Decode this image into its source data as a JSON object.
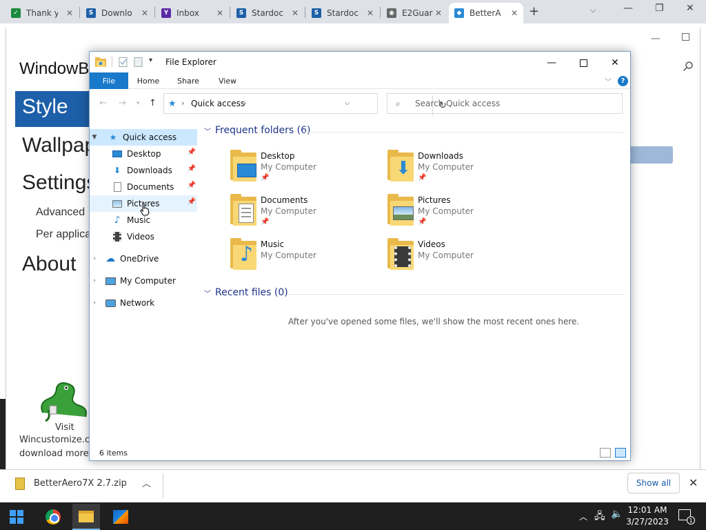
{
  "browser": {
    "tabs": [
      {
        "label": "Thank yo",
        "fav_color": "#1b8a3c",
        "fav_glyph": "✓"
      },
      {
        "label": "Downlo",
        "fav_color": "#1d5fa8",
        "fav_glyph": "S"
      },
      {
        "label": "Inbox",
        "fav_color": "#5b2aa6",
        "fav_glyph": "Y"
      },
      {
        "label": "Stardoc",
        "fav_color": "#1d5fa8",
        "fav_glyph": "S"
      },
      {
        "label": "Stardoc",
        "fav_color": "#1d5fa8",
        "fav_glyph": "S"
      },
      {
        "label": "E2Guar",
        "fav_color": "#666666",
        "fav_glyph": "◉"
      },
      {
        "label": "BetterA",
        "fav_color": "#2a8ad4",
        "fav_glyph": "◆"
      }
    ],
    "new_tab": "+"
  },
  "background_app": {
    "title": "WindowB",
    "nav_active": "Style",
    "nav": [
      "Wallpap",
      "Settings"
    ],
    "sub": [
      "Advanced",
      "Per applicat"
    ],
    "about": "About",
    "visit": "Visit",
    "wincustomize": "Wincustomize.co",
    "download_more": "download more s"
  },
  "downloads": {
    "filename": "BetterAero7X 2.7.zip",
    "show_all": "Show all"
  },
  "taskbar": {
    "time": "12:01 AM",
    "date": "3/27/2023",
    "notifications": "1"
  },
  "explorer": {
    "title": "File Explorer",
    "ribbon_tabs": [
      "File",
      "Home",
      "Share",
      "View"
    ],
    "help": "?",
    "address": "Quick access",
    "search_placeholder": "Search Quick access",
    "nav": {
      "quick_access": "Quick access",
      "pinned": [
        "Desktop",
        "Downloads",
        "Documents",
        "Pictures",
        "Music",
        "Videos"
      ],
      "onedrive": "OneDrive",
      "my_computer": "My Computer",
      "network": "Network"
    },
    "frequent_header": "Frequent folders (6)",
    "folders": [
      {
        "name": "Desktop",
        "location": "My Computer",
        "pinned": true
      },
      {
        "name": "Downloads",
        "location": "My Computer",
        "pinned": true
      },
      {
        "name": "Documents",
        "location": "My Computer",
        "pinned": true
      },
      {
        "name": "Pictures",
        "location": "My Computer",
        "pinned": true
      },
      {
        "name": "Music",
        "location": "My Computer",
        "pinned": false
      },
      {
        "name": "Videos",
        "location": "My Computer",
        "pinned": false
      }
    ],
    "recent_header": "Recent files (0)",
    "recent_empty": "After you've opened some files, we'll show the most recent ones here.",
    "status": "6 items"
  },
  "colors": {
    "accent": "#1979ca",
    "selection": "#cce8ff",
    "group_header": "#1e3287",
    "folder": "#f8d775"
  }
}
